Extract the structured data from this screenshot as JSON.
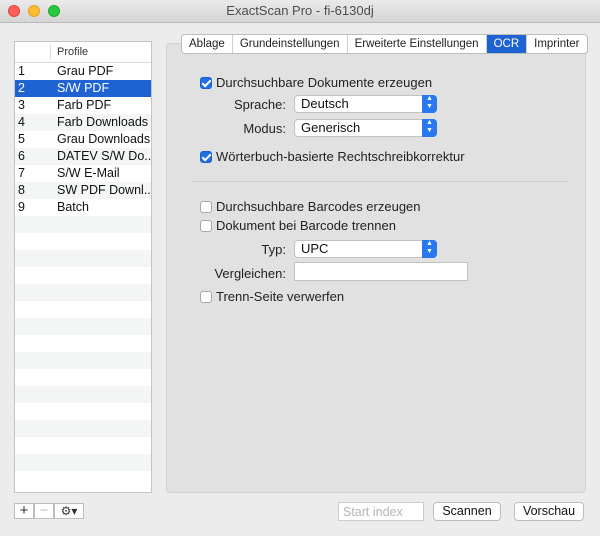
{
  "window": {
    "title": "ExactScan Pro - fi-6130dj"
  },
  "profiles": {
    "header": "Profile",
    "items": [
      {
        "num": "1",
        "name": "Grau PDF"
      },
      {
        "num": "2",
        "name": "S/W PDF"
      },
      {
        "num": "3",
        "name": "Farb PDF"
      },
      {
        "num": "4",
        "name": "Farb Downloads"
      },
      {
        "num": "5",
        "name": "Grau Downloads"
      },
      {
        "num": "6",
        "name": "DATEV S/W Do..."
      },
      {
        "num": "7",
        "name": "S/W E-Mail"
      },
      {
        "num": "8",
        "name": "SW PDF Downl..."
      },
      {
        "num": "9",
        "name": "Batch"
      }
    ],
    "selected_index": 1
  },
  "toolbar": {
    "add": "+",
    "remove": "−",
    "gear": "⚙▾"
  },
  "tabs": [
    "Ablage",
    "Grundeinstellungen",
    "Erweiterte Einstellungen",
    "OCR",
    "Imprinter"
  ],
  "active_tab": "OCR",
  "ocr": {
    "searchable_docs": {
      "label": "Durchsuchbare Dokumente erzeugen",
      "checked": true
    },
    "language": {
      "label": "Sprache:",
      "value": "Deutsch"
    },
    "mode": {
      "label": "Modus:",
      "value": "Generisch"
    },
    "dictionary": {
      "label": "Wörterbuch-basierte Rechtschreibkorrektur",
      "checked": true
    }
  },
  "barcode": {
    "searchable_barcodes": {
      "label": "Durchsuchbare Barcodes erzeugen",
      "checked": false
    },
    "split_on_barcode": {
      "label": "Dokument bei Barcode trennen",
      "checked": false
    },
    "type": {
      "label": "Typ:",
      "value": "UPC"
    },
    "compare": {
      "label": "Vergleichen:",
      "value": ""
    },
    "discard_separator": {
      "label": "Trenn-Seite verwerfen",
      "checked": false
    }
  },
  "footer": {
    "start_index_placeholder": "Start index",
    "scan_label": "Scannen",
    "preview_label": "Vorschau"
  },
  "colors": {
    "accent": "#1f63d3",
    "checkbox": "#1f6fe5"
  }
}
